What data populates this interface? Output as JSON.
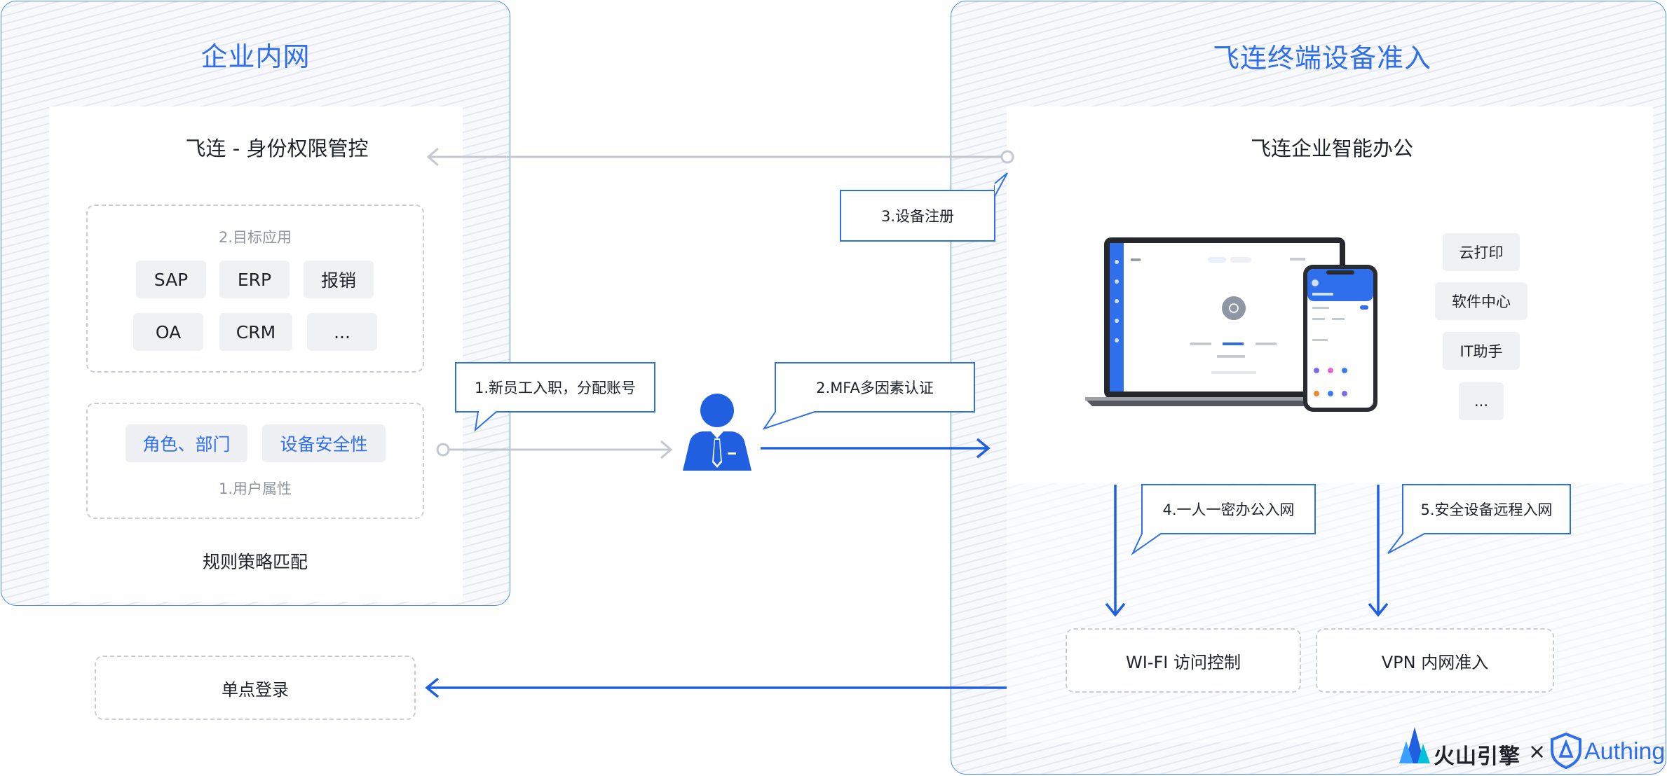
{
  "left_panel": {
    "title": "企业内网",
    "heading": "飞连 - 身份权限管控",
    "target_apps": {
      "label": "2.目标应用",
      "apps": [
        "SAP",
        "ERP",
        "报销",
        "OA",
        "CRM",
        "..."
      ]
    },
    "user_attrs": {
      "chips": [
        "角色、部门",
        "设备安全性"
      ],
      "label": "1.用户属性"
    },
    "rule_label": "规则策略匹配"
  },
  "sso_label": "单点登录",
  "callouts": {
    "onboard": "1.新员工入职，分配账号",
    "mfa": "2.MFA多因素认证",
    "register": "3.设备注册",
    "one_key": "4.一人一密办公入网",
    "remote": "5.安全设备远程入网"
  },
  "right_panel": {
    "title": "飞连终端设备准入",
    "heading": "飞连企业智能办公",
    "services": [
      "云打印",
      "软件中心",
      "IT助手",
      "..."
    ],
    "wifi_label": "WI-FI 访问控制",
    "vpn_label": "VPN 内网准入"
  },
  "brand": {
    "volcano": "火山引擎",
    "times": "×",
    "authing": "Authing"
  },
  "colors": {
    "accent": "#2f6fec",
    "arrow_blue": "#1f5fe0",
    "arrow_gray": "#c3c8d0",
    "border_blue": "#4d8bf0"
  }
}
